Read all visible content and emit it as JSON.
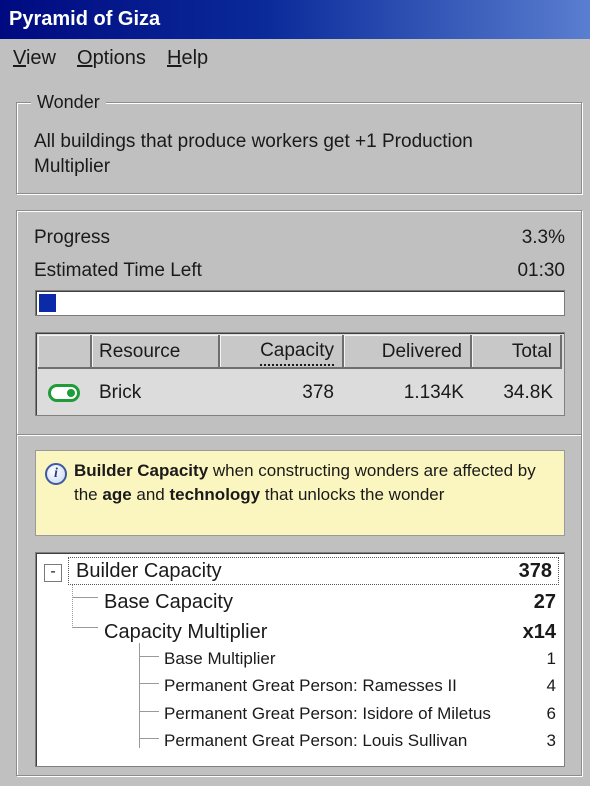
{
  "window": {
    "title": "Pyramid of Giza"
  },
  "menu": {
    "items": [
      {
        "label": "View",
        "accel": "V",
        "rest": "iew"
      },
      {
        "label": "Options",
        "accel": "O",
        "rest": "ptions"
      },
      {
        "label": "Help",
        "accel": "H",
        "rest": "elp"
      }
    ]
  },
  "wonder": {
    "legend": "Wonder",
    "description": "All buildings that produce workers get +1 Production Multiplier"
  },
  "progress": {
    "label": "Progress",
    "value": "3.3%",
    "fraction": 0.033,
    "time_label": "Estimated Time Left",
    "time_value": "01:30"
  },
  "resources": {
    "headers": {
      "resource": "Resource",
      "capacity": "Capacity",
      "delivered": "Delivered",
      "total": "Total"
    },
    "rows": [
      {
        "enabled": true,
        "resource": "Brick",
        "capacity": "378",
        "delivered": "1.134K",
        "total": "34.8K"
      }
    ]
  },
  "info": {
    "icon": "info-icon",
    "p1": "Builder Capacity",
    "p2": " when constructing wonders are affected by the ",
    "p3": "age",
    "p4": " and ",
    "p5": "technology",
    "p6": " that unlocks the wonder"
  },
  "tree": {
    "collapse_symbol": "-",
    "root": {
      "label": "Builder Capacity",
      "value": "378"
    },
    "base": {
      "label": "Base Capacity",
      "value": "27"
    },
    "multiplier": {
      "label": "Capacity Multiplier",
      "value": "x14"
    },
    "children": [
      {
        "label": "Base Multiplier",
        "value": "1"
      },
      {
        "label": "Permanent Great Person: Ramesses II",
        "value": "4"
      },
      {
        "label": "Permanent Great Person: Isidore of Miletus",
        "value": "6"
      },
      {
        "label": "Permanent Great Person: Louis Sullivan",
        "value": "3"
      }
    ]
  }
}
